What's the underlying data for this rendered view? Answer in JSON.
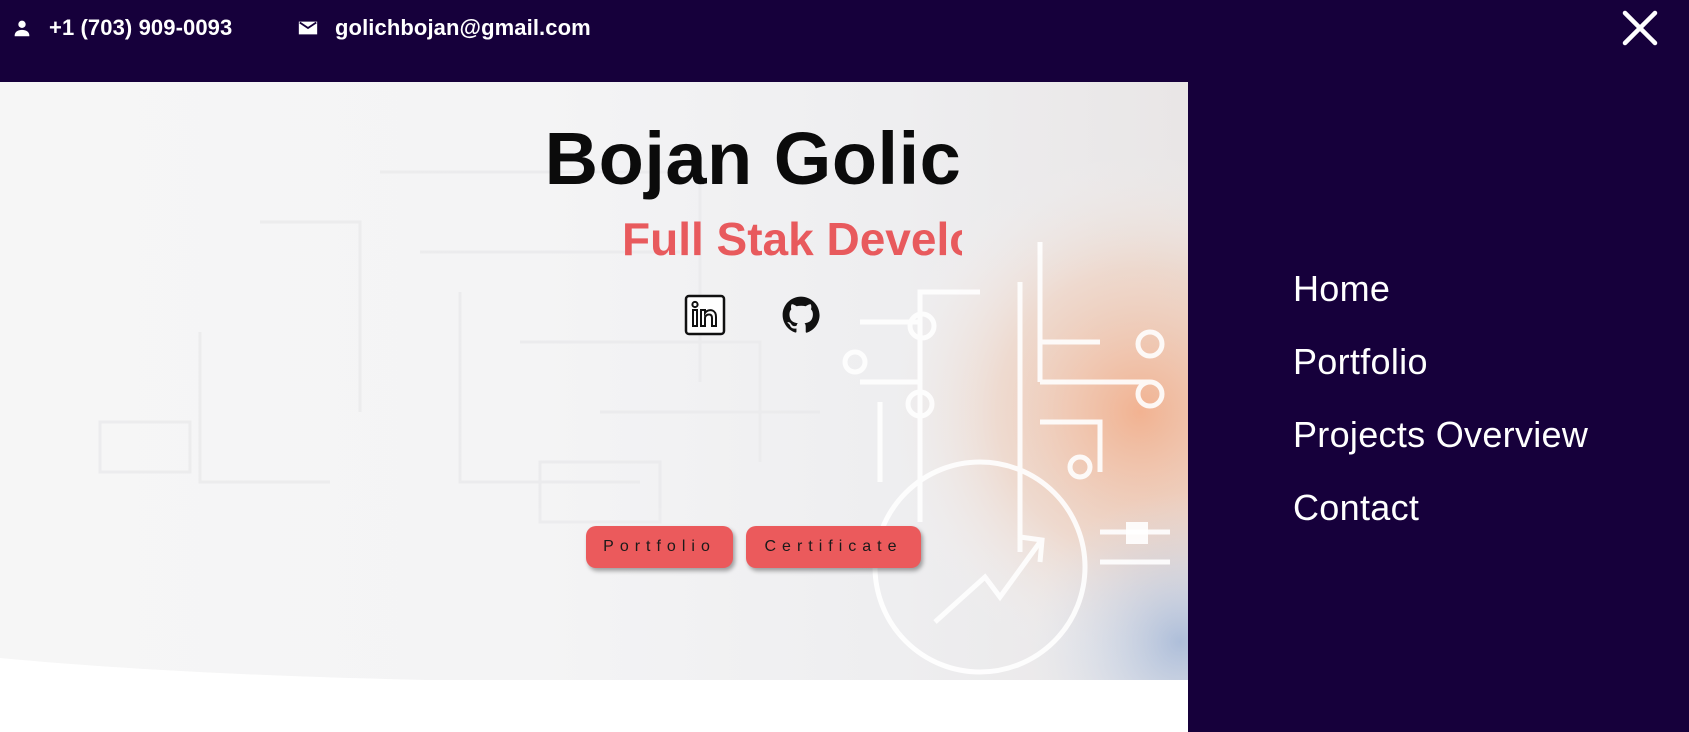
{
  "topbar": {
    "phone": {
      "icon": "person-icon",
      "text": "+1 (703) 909-0093"
    },
    "email": {
      "icon": "mail-icon",
      "text": "golichbojan@gmail.com"
    },
    "close_icon": "close-icon"
  },
  "hero": {
    "name": "Bojan Golic",
    "tagline": "Full Stak Develo",
    "social": [
      {
        "name": "linkedin-icon"
      },
      {
        "name": "github-icon"
      }
    ],
    "buttons": {
      "portfolio": "Portfolio",
      "certificate": "Certificate"
    }
  },
  "menu": {
    "items": [
      {
        "label": "Home"
      },
      {
        "label": "Portfolio"
      },
      {
        "label": "Projects Overview"
      },
      {
        "label": "Contact"
      }
    ]
  },
  "colors": {
    "navy": "#16003b",
    "accent": "#eb5a5c",
    "tagline": "#e85a5d"
  }
}
